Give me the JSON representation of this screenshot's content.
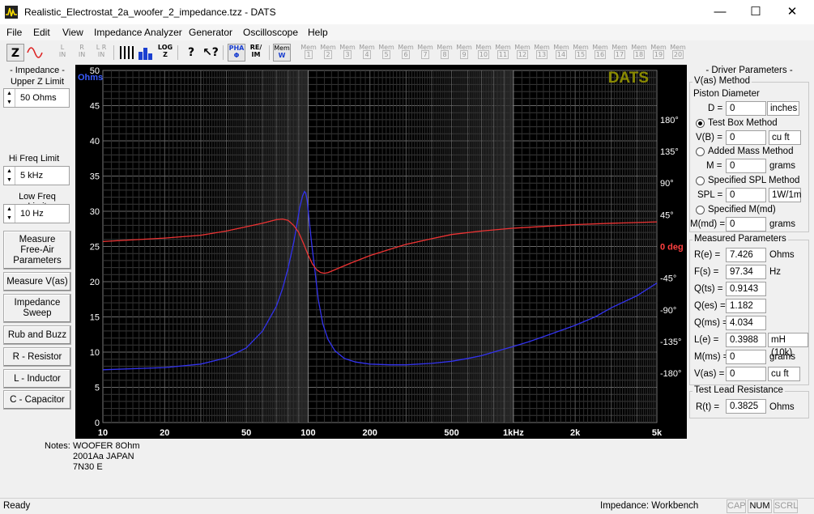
{
  "window": {
    "title": "Realistic_Electrostat_2a_woofer_2_impedance.tzz - DATS",
    "minimize": "—",
    "maximize": "☐",
    "close": "✕"
  },
  "menu": [
    "File",
    "Edit",
    "View",
    "Impedance Analyzer",
    "Generator",
    "Oscilloscope",
    "Help"
  ],
  "toolbar": {
    "z_label": "Z",
    "ln": [
      "L",
      "IN"
    ],
    "rn": [
      "R",
      "IN"
    ],
    "lrn": [
      "L R",
      "IN"
    ],
    "logz": [
      "LOG",
      "Z"
    ],
    "pha": [
      "PHA",
      "Φ"
    ],
    "reim": [
      "RE/",
      "IM"
    ],
    "mem_w": [
      "Mem",
      "W"
    ],
    "mem_slots": [
      "1",
      "2",
      "3",
      "4",
      "5",
      "6",
      "7",
      "8",
      "9",
      "10",
      "11",
      "12",
      "13",
      "14",
      "15",
      "16",
      "17",
      "18",
      "19",
      "20"
    ],
    "mem_label": "Mem"
  },
  "left": {
    "impedance_label": [
      "- Impedance -",
      "Upper Z Limit"
    ],
    "upper_z": "50 Ohms",
    "hi_freq_label": "Hi Freq Limit",
    "hi_freq": "5 kHz",
    "low_freq_label": "Low Freq Limit",
    "low_freq": "10 Hz",
    "buttons": {
      "free_air": [
        "Measure",
        "Free-Air",
        "Parameters"
      ],
      "measure_vas": "Measure V(as)",
      "sweep": [
        "Impedance",
        "Sweep"
      ],
      "rub_buzz": "Rub and Buzz",
      "resistor": "R - Resistor",
      "inductor": "L - Inductor",
      "capacitor": "C - Capacitor"
    }
  },
  "chart_data": {
    "type": "line",
    "title": "DATS",
    "xscale": "log",
    "xlim": [
      10,
      5000
    ],
    "x_ticks": [
      10,
      20,
      50,
      100,
      200,
      500,
      1000,
      2000,
      5000
    ],
    "x_tick_labels": [
      "10",
      "20",
      "50",
      "100",
      "200",
      "500",
      "1kHz",
      "2k",
      "5k"
    ],
    "ylabel": "Ohms",
    "ylim": [
      0,
      50
    ],
    "y_ticks": [
      "0",
      "5",
      "10",
      "15",
      "20",
      "25",
      "30",
      "35",
      "40",
      "45",
      "50"
    ],
    "y2label": "deg",
    "y2lim": [
      -250,
      250
    ],
    "y2_ticks": [
      {
        "value": 180,
        "label": "180°"
      },
      {
        "value": 135,
        "label": "135°"
      },
      {
        "value": 90,
        "label": "90°"
      },
      {
        "value": 45,
        "label": "45°"
      },
      {
        "value": 0,
        "label": "0 deg"
      },
      {
        "value": -45,
        "label": "-45°"
      },
      {
        "value": -90,
        "label": "-90°"
      },
      {
        "value": -135,
        "label": "-135°"
      },
      {
        "value": -180,
        "label": "-180°"
      }
    ],
    "grid": true,
    "colors": {
      "background": "#000000",
      "grid": "#5a5a5a",
      "impedance": "#3333ee",
      "phase": "#ee3333",
      "brand": "#8a8a00"
    },
    "series": [
      {
        "axis": "left",
        "x": [
          10,
          20,
          30,
          40,
          50,
          60,
          70,
          75,
          80,
          85,
          88,
          91,
          94,
          96,
          97.34,
          99,
          101,
          104,
          108,
          112,
          118,
          125,
          135,
          150,
          170,
          200,
          250,
          300,
          400,
          500,
          600,
          700,
          800,
          1000,
          1200,
          1500,
          2000,
          2500,
          3000,
          4000,
          5000
        ],
        "y": [
          7.5,
          7.8,
          8.3,
          9.2,
          10.6,
          13.0,
          16.5,
          19.0,
          22.0,
          25.5,
          28.0,
          30.5,
          32.2,
          32.8,
          32.6,
          31.5,
          29.0,
          25.5,
          21.5,
          17.5,
          14.0,
          11.8,
          10.2,
          9.1,
          8.6,
          8.3,
          8.2,
          8.2,
          8.4,
          8.7,
          9.1,
          9.5,
          10.0,
          10.8,
          11.5,
          12.5,
          13.8,
          15.0,
          16.3,
          18.0,
          19.8
        ]
      },
      {
        "axis": "right",
        "x": [
          10,
          20,
          30,
          40,
          50,
          60,
          70,
          75,
          80,
          85,
          90,
          95,
          100,
          105,
          110,
          115,
          120,
          125,
          130,
          140,
          160,
          200,
          250,
          300,
          400,
          500,
          700,
          1000,
          1500,
          2000,
          3000,
          4000,
          5000
        ],
        "y": [
          7,
          12,
          16,
          22,
          28,
          33,
          38,
          39,
          37,
          30,
          20,
          4,
          -12,
          -25,
          -33,
          -37,
          -38,
          -37,
          -35,
          -31,
          -24,
          -13,
          -4,
          3,
          11,
          17,
          22,
          26,
          29,
          31,
          33,
          34,
          35
        ]
      }
    ]
  },
  "notes": {
    "label": "Notes:",
    "lines": [
      "WOOFER 8Ohm",
      "2001Aa   JAPAN",
      "7N30 E"
    ]
  },
  "driver": {
    "title": "- Driver Parameters -",
    "vas_method": "V(as) Method",
    "piston_diameter": "Piston Diameter",
    "d_label": "D =",
    "d_value": "0",
    "d_unit": "inches",
    "test_box": "Test Box Method",
    "vb_label": "V(B) =",
    "vb_value": "0",
    "vb_unit": "cu ft",
    "added_mass": "Added Mass Method",
    "m_label": "M =",
    "m_value": "0",
    "m_unit": "grams",
    "spl_method": "Specified SPL Method",
    "spl_label": "SPL =",
    "spl_value": "0",
    "spl_unit": "1W/1m",
    "specified_mmd": "Specified M(md)",
    "mmd_label": "M(md) =",
    "mmd_value": "0",
    "mmd_unit": "grams"
  },
  "measured": {
    "title": "Measured Parameters",
    "rows": [
      {
        "label": "R(e) =",
        "value": "7.426",
        "unit": "Ohms"
      },
      {
        "label": "F(s) =",
        "value": "97.34",
        "unit": "Hz"
      },
      {
        "label": "Q(ts) =",
        "value": "0.9143",
        "unit": ""
      },
      {
        "label": "Q(es) =",
        "value": "1.182",
        "unit": ""
      },
      {
        "label": "Q(ms) =",
        "value": "4.034",
        "unit": ""
      },
      {
        "label": "L(e) =",
        "value": "0.3988",
        "unit": "mH (10k)"
      },
      {
        "label": "M(ms) =",
        "value": "0",
        "unit": "grams"
      },
      {
        "label": "V(as) =",
        "value": "0",
        "unit": "cu ft"
      }
    ]
  },
  "lead": {
    "title": "Test Lead Resistance",
    "label": "R(t) =",
    "value": "0.3825",
    "unit": "Ohms"
  },
  "status": {
    "left": "Ready",
    "mode": "Impedance: Workbench",
    "cap": "CAP",
    "num": "NUM",
    "scrl": "SCRL"
  }
}
